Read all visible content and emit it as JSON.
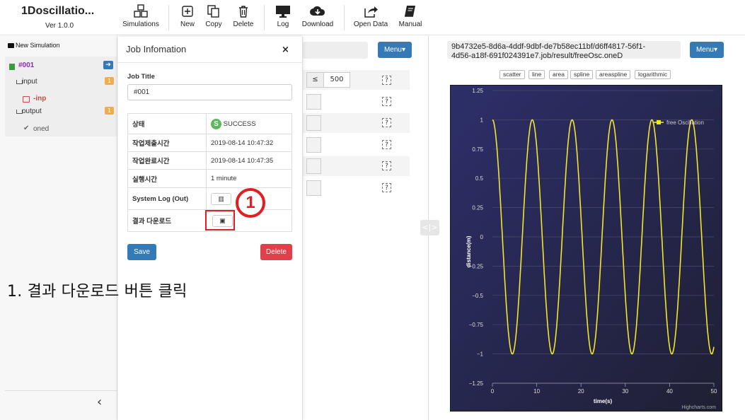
{
  "app": {
    "title": "1Doscillatio...",
    "version": "Ver 1.0.0"
  },
  "toolbar": [
    {
      "label": "Simulations",
      "icon": "cubes-icon"
    },
    {
      "label": "New",
      "icon": "plus-square-icon"
    },
    {
      "label": "Copy",
      "icon": "copy-icon"
    },
    {
      "label": "Delete",
      "icon": "trash-icon"
    },
    {
      "label": "Log",
      "icon": "monitor-icon"
    },
    {
      "label": "Download",
      "icon": "cloud-download-icon"
    },
    {
      "label": "Open Data",
      "icon": "share-icon"
    },
    {
      "label": "Manual",
      "icon": "book-icon"
    }
  ],
  "sidebar": {
    "new_simulation": "New Simulation",
    "job": "#001",
    "input_label": "input",
    "input_badge": "1",
    "input_file": "-inp",
    "output_label": "output",
    "output_badge": "1",
    "output_file": "oned",
    "collapse": "‹"
  },
  "editor": {
    "operator": "≤",
    "value": "500",
    "help": "?"
  },
  "modal": {
    "title": "Job Infomation",
    "close": "×",
    "job_title_label": "Job Title",
    "job_title_value": "#001",
    "rows": {
      "status_key": "상태",
      "status_icon": "S",
      "status_value": "SUCCESS",
      "submit_key": "작업제출시간",
      "submit_value": "2019-08-14 10:47:32",
      "complete_key": "작업완료시간",
      "complete_value": "2019-08-14 10:47:35",
      "exec_key": "실행시간",
      "exec_value": "1 minute",
      "syslog_key": "System Log (Out)",
      "download_key": "결과 다운로드"
    },
    "save": "Save",
    "delete": "Delete",
    "callout": "1"
  },
  "menu_button": "Menu▾",
  "result": {
    "path": "9b4732e5-8d6a-4ddf-9dbf-de7b58ec11bf/d6ff4817-56f1-4d56-a18f-691f024391e7.job/result/freeOsc.oneD",
    "path_line1": "9b4732e5-8d6a-4ddf-9dbf-de7b58ec11bf/d6ff4817-56f1-",
    "path_line2": "4d56-a18f-691f024391e7.job/result/freeOsc.oneD",
    "chart_types": [
      "scatter",
      "line",
      "area",
      "spline",
      "areaspline",
      "logarithmic"
    ]
  },
  "instruction": "1. 결과 다운로드 버튼 클릭",
  "colors": {
    "primary": "#337ab7",
    "danger": "#d9534f",
    "success": "#5cb85c",
    "badge": "#f0ad4e",
    "highlight": "#e02020",
    "plot_bg": "#2b2a5a",
    "series": "#f2e62a"
  },
  "chart_data": {
    "type": "line",
    "xlabel": "time(s)",
    "ylabel": "distance(m)",
    "credits": "Highcharts.com",
    "xlim": [
      0,
      50
    ],
    "ylim": [
      -1.25,
      1.25
    ],
    "xticks": [
      0,
      10,
      20,
      30,
      40,
      50
    ],
    "yticks": [
      1.25,
      1,
      0.75,
      0.5,
      0.25,
      0,
      -0.25,
      -0.5,
      -0.75,
      -1,
      -1.25
    ],
    "ytick_labels": [
      "1.25",
      "1",
      "0.75",
      "0.5",
      "0.25",
      "0",
      "−0.25",
      "−0.5",
      "−0.75",
      "−1",
      "−1.25"
    ],
    "legend_position": "top-right",
    "series": [
      {
        "name": "free Oscillation",
        "function": "cos",
        "amplitude": 1,
        "period": 9,
        "x_start": 0,
        "x_end": 50,
        "sample_step": 0.1
      }
    ]
  }
}
